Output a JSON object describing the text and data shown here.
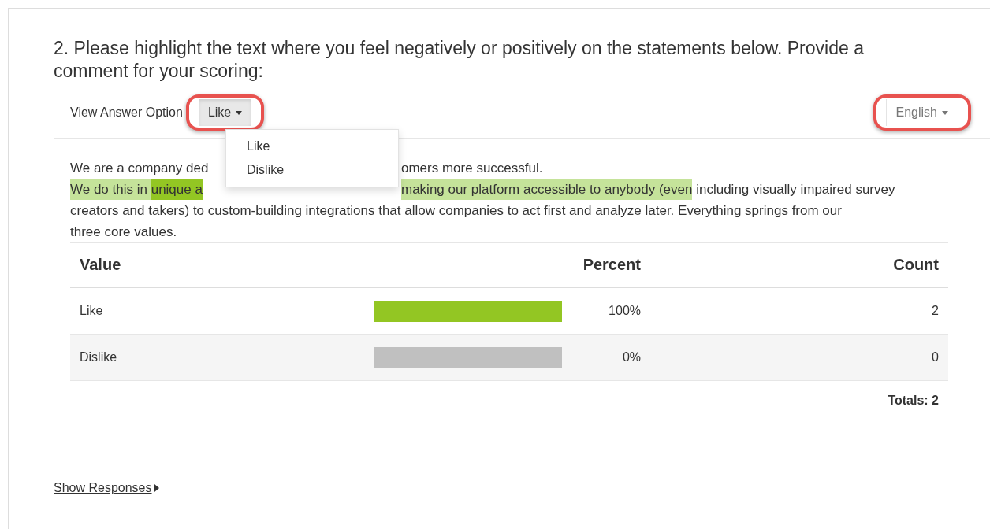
{
  "question": {
    "title": "2. Please highlight the text where you feel negatively or positively on the statements below. Provide a comment for your scoring:"
  },
  "toolbar": {
    "label": "View Answer Option",
    "option_button": "Like",
    "language_button": "English"
  },
  "option_menu": {
    "items": [
      {
        "label": "Like",
        "selected": false
      },
      {
        "label": "Dislike",
        "selected": false
      }
    ]
  },
  "passage": {
    "lines": [
      {
        "before": [
          {
            "text": "We are a company ded"
          }
        ],
        "after": [
          {
            "text": "omers more successful."
          }
        ]
      },
      {
        "before": [
          {
            "text": "We do this in ",
            "color": "#c5e39a"
          },
          {
            "text": "unique a",
            "color": "#93c623"
          }
        ],
        "after": [
          {
            "text": "making our platform accessible to anybody (even",
            "color": "#c5e39a"
          },
          {
            "text": " including visually impaired survey"
          }
        ]
      },
      {
        "before": [
          {
            "text": "creators and takers) to custom-building integrations that allow companies to act first and analyze later. Everything springs from our"
          }
        ]
      },
      {
        "before": [
          {
            "text": "three core values."
          }
        ]
      }
    ]
  },
  "table": {
    "columns": [
      "Value",
      "Percent",
      "Count"
    ],
    "rows": [
      {
        "value": "Like",
        "level": 1,
        "percent": "100%",
        "count": "2"
      },
      {
        "value": "Dislike",
        "level": 0,
        "percent": "0%",
        "count": "0"
      }
    ],
    "totals": "Totals: 2"
  },
  "show_responses": "Show Responses"
}
